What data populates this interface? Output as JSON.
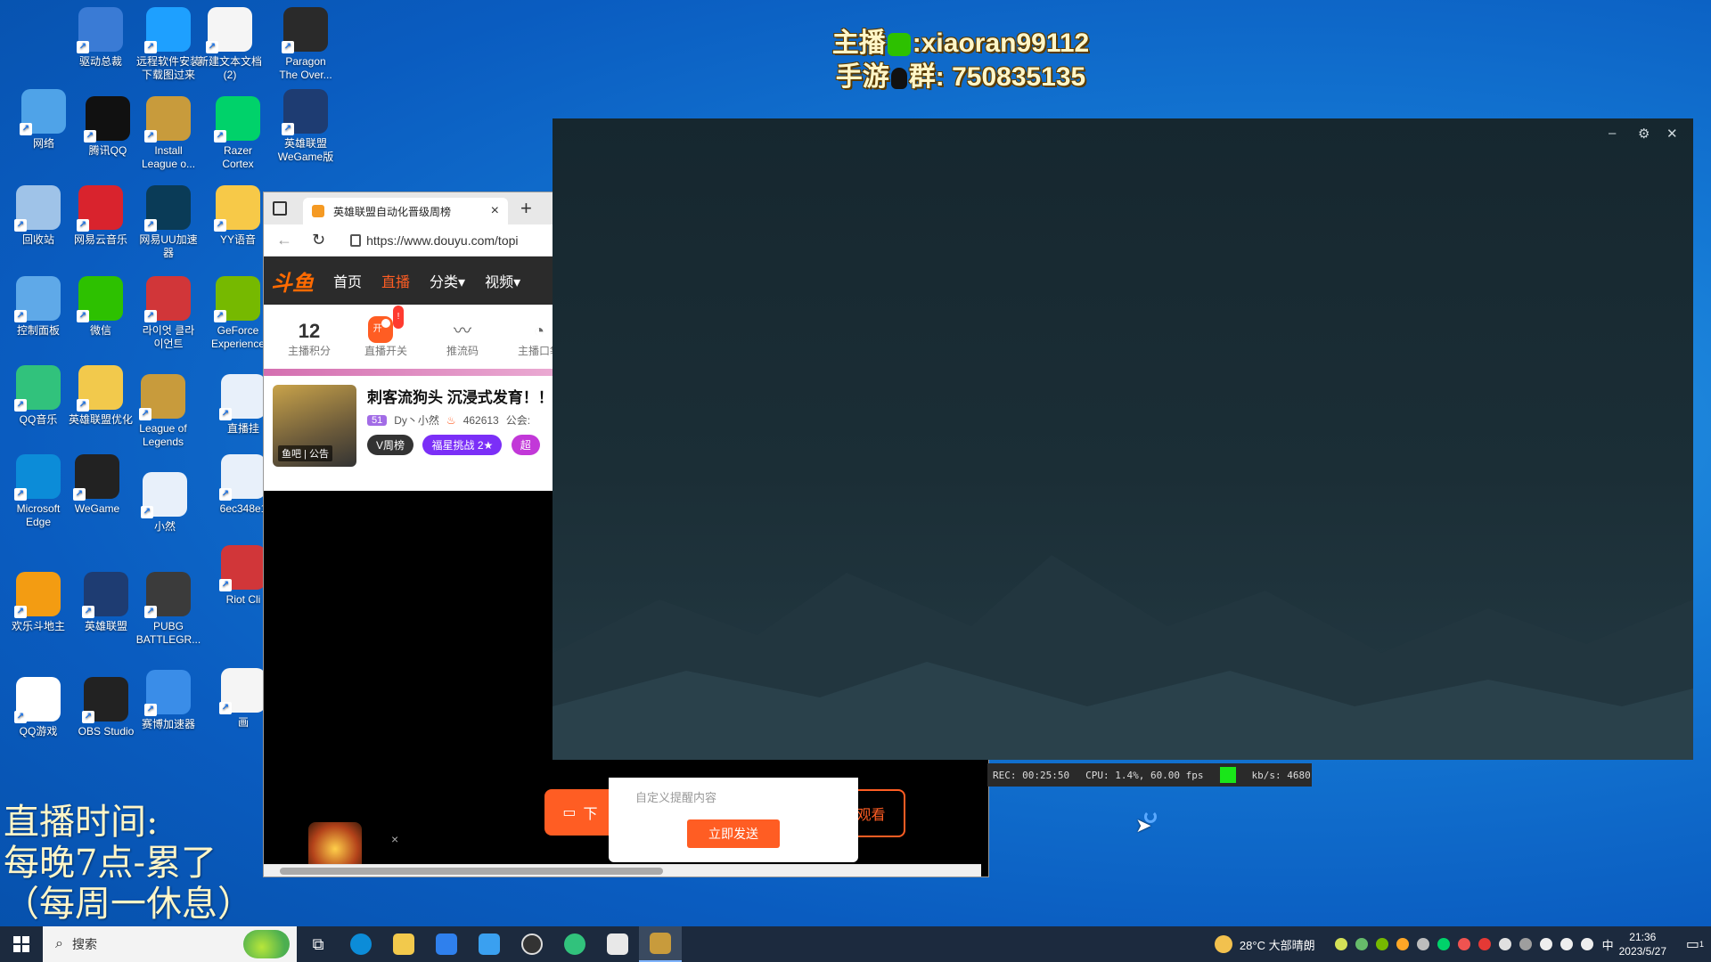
{
  "desktop_icons": [
    {
      "label": "驱动总裁",
      "icon": "driver-icon",
      "color": "#3a7bd5"
    },
    {
      "label": "远程软件安装\n下载图过来",
      "icon": "remote-icon",
      "color": "#1ea0ff"
    },
    {
      "label": "新建文本文档\n(2)",
      "icon": "text-file-icon",
      "color": "#f5f5f5"
    },
    {
      "label": "Paragon\nThe Over...",
      "icon": "paragon-icon",
      "color": "#2a2a2a"
    },
    {
      "label": "网络",
      "icon": "network-icon",
      "color": "#4fa3e8"
    },
    {
      "label": "腾讯QQ",
      "icon": "qq-icon",
      "color": "#111111"
    },
    {
      "label": "Install\nLeague o...",
      "icon": "league-icon",
      "color": "#c89b3c"
    },
    {
      "label": "Razer\nCortex",
      "icon": "razer-icon",
      "color": "#00d26a"
    },
    {
      "label": "英雄联盟\nWeGame版",
      "icon": "league-wegame-icon",
      "color": "#1e3c72"
    },
    {
      "label": "回收站",
      "icon": "recycle-bin-icon",
      "color": "#9fc3e8"
    },
    {
      "label": "网易云音乐",
      "icon": "netease-music-icon",
      "color": "#d9232d"
    },
    {
      "label": "网易UU加速\n器",
      "icon": "uu-icon",
      "color": "#0a3b57"
    },
    {
      "label": "YY语音",
      "icon": "yy-icon",
      "color": "#f7c948"
    },
    {
      "label": "控制面板",
      "icon": "control-panel-icon",
      "color": "#5fa9e8"
    },
    {
      "label": "微信",
      "icon": "wechat-icon",
      "color": "#2dc100"
    },
    {
      "label": "라이엇 클라\n이언트",
      "icon": "riot-icon",
      "color": "#d13639"
    },
    {
      "label": "GeForce\nExperience",
      "icon": "geforce-icon",
      "color": "#76b900"
    },
    {
      "label": "QQ音乐",
      "icon": "qq-music-icon",
      "color": "#31c27c"
    },
    {
      "label": "英雄联盟优化",
      "icon": "folder-icon",
      "color": "#f2c94c"
    },
    {
      "label": "League of\nLegends",
      "icon": "league-icon",
      "color": "#c89b3c"
    },
    {
      "label": "直播挂",
      "icon": "image-icon",
      "color": "#e8f0fa"
    },
    {
      "label": "Microsoft\nEdge",
      "icon": "edge-icon",
      "color": "#0c8cd8"
    },
    {
      "label": "WeGame",
      "icon": "wegame-icon",
      "color": "#222222"
    },
    {
      "label": "小然",
      "icon": "image-icon",
      "color": "#e8f0fa"
    },
    {
      "label": "6ec348e1",
      "icon": "image-icon",
      "color": "#e8f0fa"
    },
    {
      "label": "欢乐斗地主",
      "icon": "doudizhu-icon",
      "color": "#f39c12"
    },
    {
      "label": "英雄联盟",
      "icon": "league-icon",
      "color": "#1e3c72"
    },
    {
      "label": "PUBG\nBATTLEGR...",
      "icon": "pubg-icon",
      "color": "#3b3b3b"
    },
    {
      "label": "Riot Cli",
      "icon": "riot-icon",
      "color": "#d13639"
    },
    {
      "label": "QQ游戏",
      "icon": "qq-game-icon",
      "color": "#ffffff"
    },
    {
      "label": "OBS Studio",
      "icon": "obs-icon",
      "color": "#222222"
    },
    {
      "label": "赛博加速器",
      "icon": "accelerator-icon",
      "color": "#3a8de8"
    },
    {
      "label": "画",
      "icon": "text-file-icon",
      "color": "#f5f5f5"
    }
  ],
  "overlay": {
    "line1_prefix": "主播",
    "line1_value": ":xiaoran99112",
    "line2_prefix": "手游",
    "line2_value": "群: 750835135",
    "schedule_1": "直播时间:",
    "schedule_2": "每晚7点-累了",
    "schedule_3": "（每周一休息）"
  },
  "browser": {
    "tab_title": "英雄联盟自动化晋级周榜",
    "url": "https://www.douyu.com/topi",
    "site": {
      "logo": "斗鱼",
      "nav": [
        "首页",
        "直播",
        "分类",
        "视频"
      ],
      "active_nav": "直播"
    },
    "tools": {
      "score_value": "12",
      "score_label": "主播积分",
      "switch_badge": "!",
      "switch_toggle": "开",
      "switch_label": "直播开关",
      "push_label": "推流码",
      "pocket_label": "主播口袋"
    },
    "anchor": {
      "title": "刺客流狗头 沉浸式发育！！",
      "level": "51",
      "name": "Dy丶小然",
      "heat": "462613",
      "guild": "公会:",
      "avatar_label": "鱼吧 | 公告",
      "chip_week": "V周榜",
      "chip_challenge": "福星挑战",
      "chip_challenge_level": "2★",
      "chip_more": "超"
    },
    "player": {
      "left_button": "下",
      "right_button": "观看",
      "popup_placeholder": "自定义提醒内容",
      "popup_send": "立即发送"
    }
  },
  "dark_window": {
    "minimize": "–",
    "settings": "⚙",
    "close": "✕"
  },
  "obs_status": {
    "rec": "REC: 00:25:50",
    "cpu": "CPU: 1.4%, 60.00 fps",
    "kbps": "kb/s: 4680",
    "status_color": "#19e619"
  },
  "taskbar": {
    "search_placeholder": "搜索",
    "weather": "28°C 大部晴朗",
    "ime": "中",
    "time": "21:36",
    "date": "2023/5/27",
    "notifications": "1"
  }
}
